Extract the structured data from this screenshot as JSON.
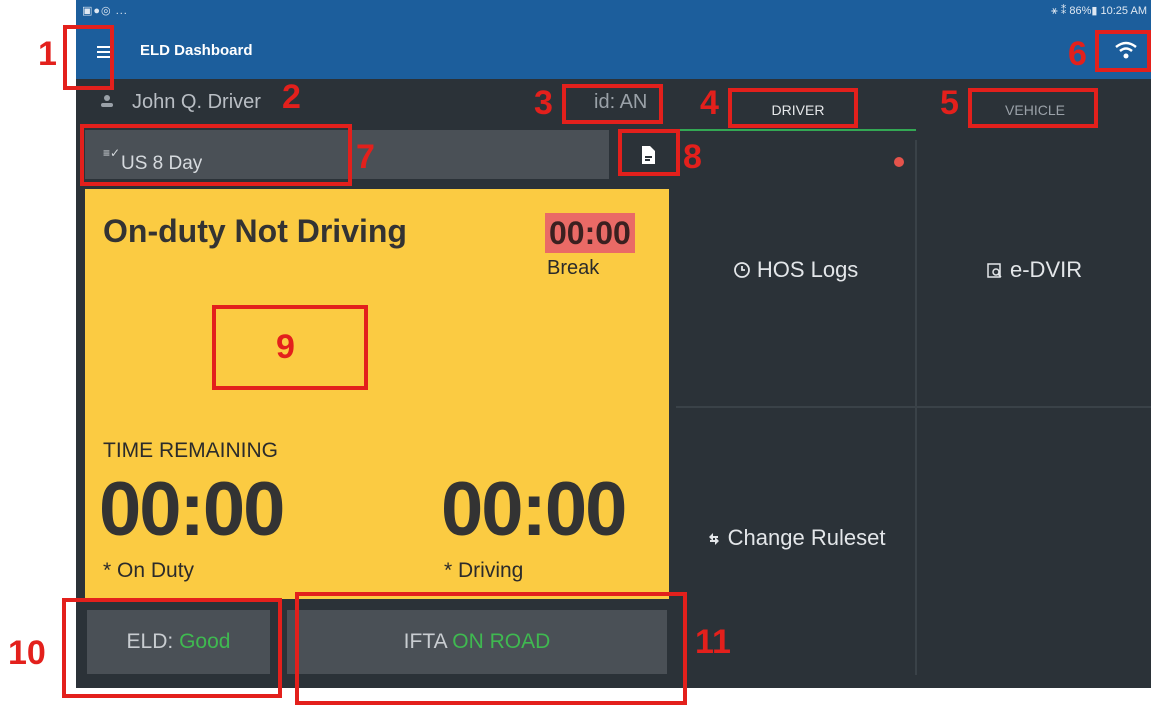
{
  "status_bar": {
    "left_icons": "▣●◎ ...",
    "right_text": "⚹ ⁑ 86%▮ 10:25 AM"
  },
  "app_bar": {
    "title": "ELD Dashboard"
  },
  "driver": {
    "name": "John Q. Driver",
    "id": "id: AN"
  },
  "ruleset": {
    "icon": "≡✓",
    "label": "US 8 Day"
  },
  "status_card": {
    "duty_status": "On-duty Not Driving",
    "break_time": "00:00",
    "break_label": "Break",
    "time_remaining_label": "TIME REMAINING",
    "on_duty_time": "00:00",
    "on_duty_label": "* On Duty",
    "driving_time": "00:00",
    "driving_label": "* Driving"
  },
  "eld": {
    "label": "ELD:",
    "status": "Good"
  },
  "ifta": {
    "label": "IFTA",
    "status": "ON ROAD"
  },
  "tabs": {
    "driver": "DRIVER",
    "vehicle": "VEHICLE"
  },
  "grid": {
    "hos_logs": "HOS Logs",
    "edvir": "e-DVIR",
    "change_ruleset": "Change Ruleset"
  },
  "annotations": [
    "1",
    "2",
    "3",
    "4",
    "5",
    "6",
    "7",
    "8",
    "9",
    "10",
    "11"
  ],
  "colors": {
    "app_bar": "#1c5e9c",
    "card": "#fbcb42",
    "break_highlight": "#ea6a66",
    "good_green": "#3fb950",
    "annotation_red": "#e3201c"
  }
}
